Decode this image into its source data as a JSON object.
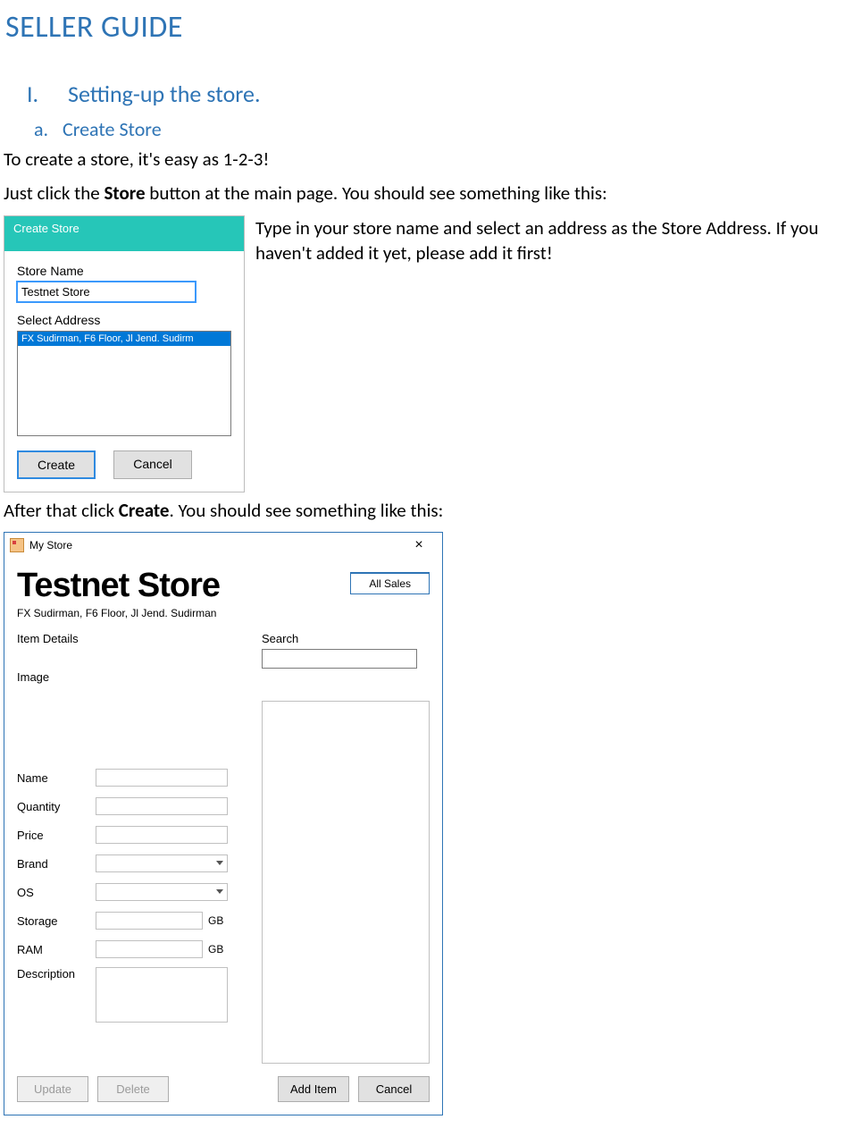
{
  "doc": {
    "title": "SELLER GUIDE",
    "section1_num": "I.",
    "section1_title": "Setting-up the store.",
    "section1a_num": "a.",
    "section1a_title": "Create Store",
    "p1": "To create a store, it's easy as 1-2-3!",
    "p2a": "Just click the ",
    "p2b": "Store",
    "p2c": " button at the main page. You should see something like this:",
    "side_text": "Type in your store name and select an address as the Store Address. If you haven't added it yet, please add it first!",
    "p3a": "After that click ",
    "p3b": "Create",
    "p3c": ". You should see something like this:"
  },
  "dlg1": {
    "title": "Create Store",
    "store_name_label": "Store Name",
    "store_name_value": "Testnet Store",
    "select_address_label": "Select Address",
    "address_item": "FX Sudirman, F6 Floor, Jl Jend. Sudirm",
    "create_btn": "Create",
    "cancel_btn": "Cancel"
  },
  "win": {
    "title": "My Store",
    "store_name": "Testnet Store",
    "store_addr": "FX Sudirman, F6 Floor, Jl Jend. Sudirman",
    "all_sales": "All Sales",
    "item_details": "Item Details",
    "image_label": "Image",
    "fields": {
      "name": "Name",
      "quantity": "Quantity",
      "price": "Price",
      "brand": "Brand",
      "os": "OS",
      "storage": "Storage",
      "ram": "RAM",
      "description": "Description"
    },
    "units": {
      "gb": "GB"
    },
    "search": "Search",
    "update_btn": "Update",
    "delete_btn": "Delete",
    "add_item_btn": "Add Item",
    "cancel_btn": "Cancel"
  }
}
